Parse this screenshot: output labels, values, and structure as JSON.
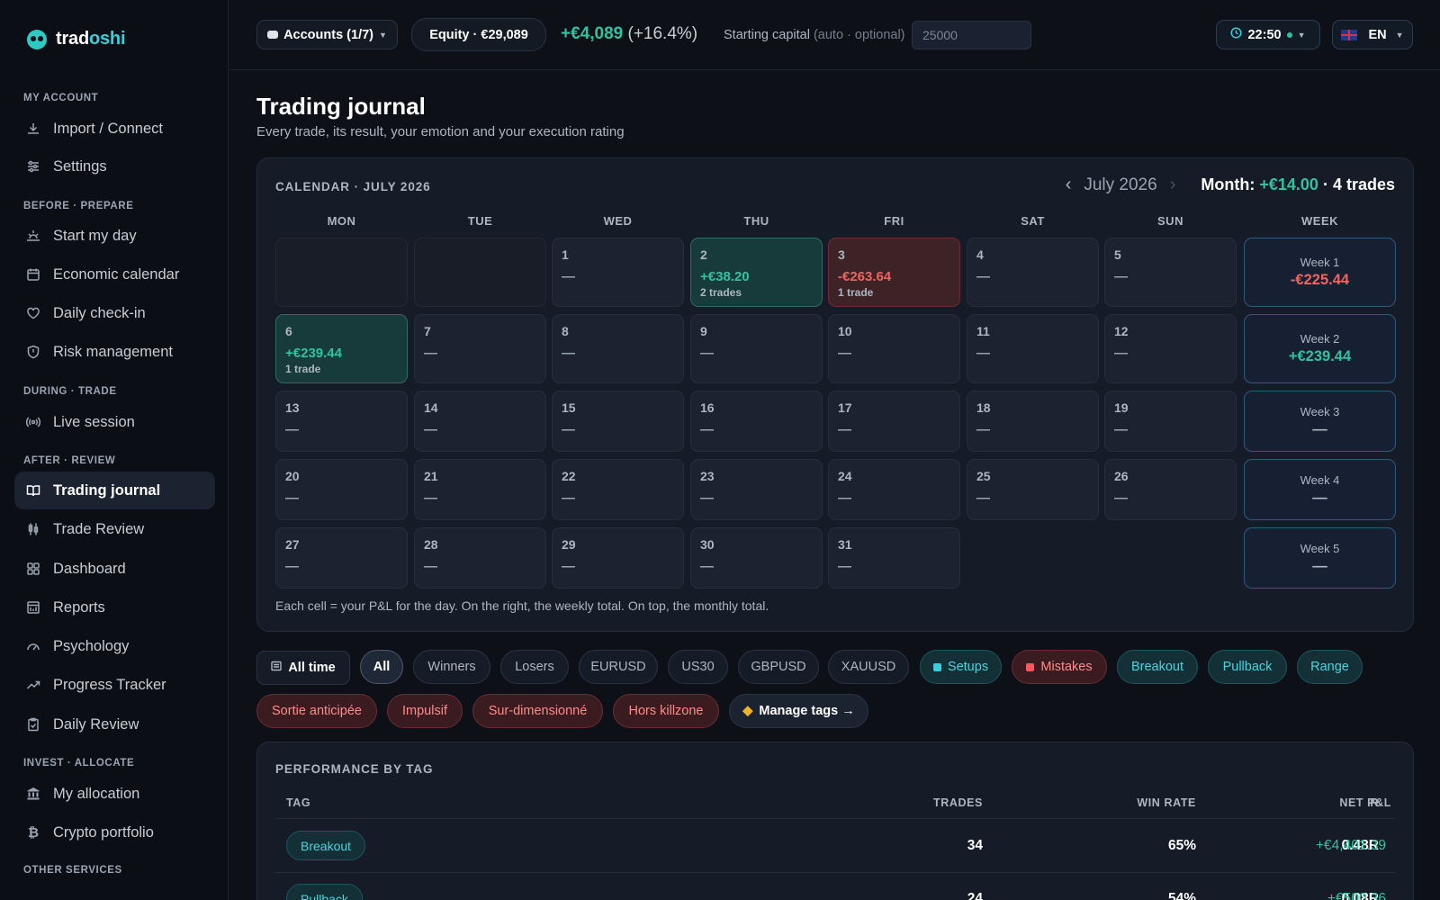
{
  "brand": {
    "name_a": "trad",
    "name_b": "oshi"
  },
  "sidebar": {
    "sections": {
      "my_account": "MY ACCOUNT",
      "before": "BEFORE · PREPARE",
      "during": "DURING · TRADE",
      "after": "AFTER · REVIEW",
      "invest": "INVEST · ALLOCATE",
      "other": "OTHER SERVICES"
    },
    "items": {
      "import": "Import / Connect",
      "settings": "Settings",
      "start_day": "Start my day",
      "economic": "Economic calendar",
      "checkin": "Daily check-in",
      "risk": "Risk management",
      "live": "Live session",
      "journal": "Trading journal",
      "review": "Trade Review",
      "dashboard": "Dashboard",
      "reports": "Reports",
      "psychology": "Psychology",
      "progress": "Progress Tracker",
      "daily_review": "Daily Review",
      "allocation": "My allocation",
      "crypto": "Crypto portfolio"
    }
  },
  "topbar": {
    "accounts": "Accounts (1/7)",
    "equity": "Equity · €29,089",
    "profit": "+€4,089",
    "profit_pct": "(+16.4%)",
    "capital_label": "Starting capital",
    "capital_hint": "(auto · optional)",
    "capital_placeholder": "25000",
    "time": "22:50",
    "lang": "EN"
  },
  "page": {
    "title": "Trading journal",
    "subtitle": "Every trade, its result, your emotion and your execution rating"
  },
  "calendar": {
    "heading": "CALENDAR · JULY 2026",
    "month": "July 2026",
    "total_label": "Month:",
    "total_value": "+€14.00",
    "total_trades": "· 4 trades",
    "dow": [
      "MON",
      "TUE",
      "WED",
      "THU",
      "FRI",
      "SAT",
      "SUN",
      "WEEK"
    ],
    "days": {
      "d1": {
        "num": "1",
        "val": "—"
      },
      "d2": {
        "num": "2",
        "val": "+€38.20",
        "trades": "2 trades"
      },
      "d3": {
        "num": "3",
        "val": "-€263.64",
        "trades": "1 trade"
      },
      "d4": {
        "num": "4",
        "val": "—"
      },
      "d5": {
        "num": "5",
        "val": "—"
      },
      "d6": {
        "num": "6",
        "val": "+€239.44",
        "trades": "1 trade"
      },
      "d7": {
        "num": "7",
        "val": "—"
      },
      "d8": {
        "num": "8",
        "val": "—"
      },
      "d9": {
        "num": "9",
        "val": "—"
      },
      "d10": {
        "num": "10",
        "val": "—"
      },
      "d11": {
        "num": "11",
        "val": "—"
      },
      "d12": {
        "num": "12",
        "val": "—"
      },
      "d13": {
        "num": "13",
        "val": "—"
      },
      "d14": {
        "num": "14",
        "val": "—"
      },
      "d15": {
        "num": "15",
        "val": "—"
      },
      "d16": {
        "num": "16",
        "val": "—"
      },
      "d17": {
        "num": "17",
        "val": "—"
      },
      "d18": {
        "num": "18",
        "val": "—"
      },
      "d19": {
        "num": "19",
        "val": "—"
      },
      "d20": {
        "num": "20",
        "val": "—"
      },
      "d21": {
        "num": "21",
        "val": "—"
      },
      "d22": {
        "num": "22",
        "val": "—"
      },
      "d23": {
        "num": "23",
        "val": "—"
      },
      "d24": {
        "num": "24",
        "val": "—"
      },
      "d25": {
        "num": "25",
        "val": "—"
      },
      "d26": {
        "num": "26",
        "val": "—"
      },
      "d27": {
        "num": "27",
        "val": "—"
      },
      "d28": {
        "num": "28",
        "val": "—"
      },
      "d29": {
        "num": "29",
        "val": "—"
      },
      "d30": {
        "num": "30",
        "val": "—"
      },
      "d31": {
        "num": "31",
        "val": "—"
      }
    },
    "weeks": [
      {
        "label": "Week 1",
        "val": "-€225.44"
      },
      {
        "label": "Week 2",
        "val": "+€239.44"
      },
      {
        "label": "Week 3",
        "val": "—"
      },
      {
        "label": "Week 4",
        "val": "—"
      },
      {
        "label": "Week 5",
        "val": "—"
      }
    ],
    "footnote": "Each cell = your P&L for the day. On the right, the weekly total. On top, the monthly total."
  },
  "filters": {
    "period": "All time",
    "all": "All",
    "winners": "Winners",
    "losers": "Losers",
    "symbols": [
      "EURUSD",
      "US30",
      "GBPUSD",
      "XAUUSD"
    ],
    "setups": "Setups",
    "mistakes": "Mistakes",
    "setup_tags": [
      "Breakout",
      "Pullback",
      "Range"
    ],
    "mistake_tags": [
      "Sortie anticipée",
      "Impulsif",
      "Sur-dimensionné",
      "Hors killzone"
    ],
    "manage": "Manage tags →"
  },
  "performance": {
    "title": "PERFORMANCE BY TAG",
    "headers": {
      "tag": "TAG",
      "trades": "TRADES",
      "win_rate": "WIN RATE",
      "r": "R",
      "pnl": "NET P&L"
    },
    "rows": [
      {
        "tag": "Breakout",
        "trades": "34",
        "win_rate": "65%",
        "r": "0.48R",
        "pnl": "+€4,401.39"
      },
      {
        "tag": "Pullback",
        "trades": "24",
        "win_rate": "54%",
        "r": "0.08R",
        "pnl": "+€500.36"
      }
    ]
  }
}
